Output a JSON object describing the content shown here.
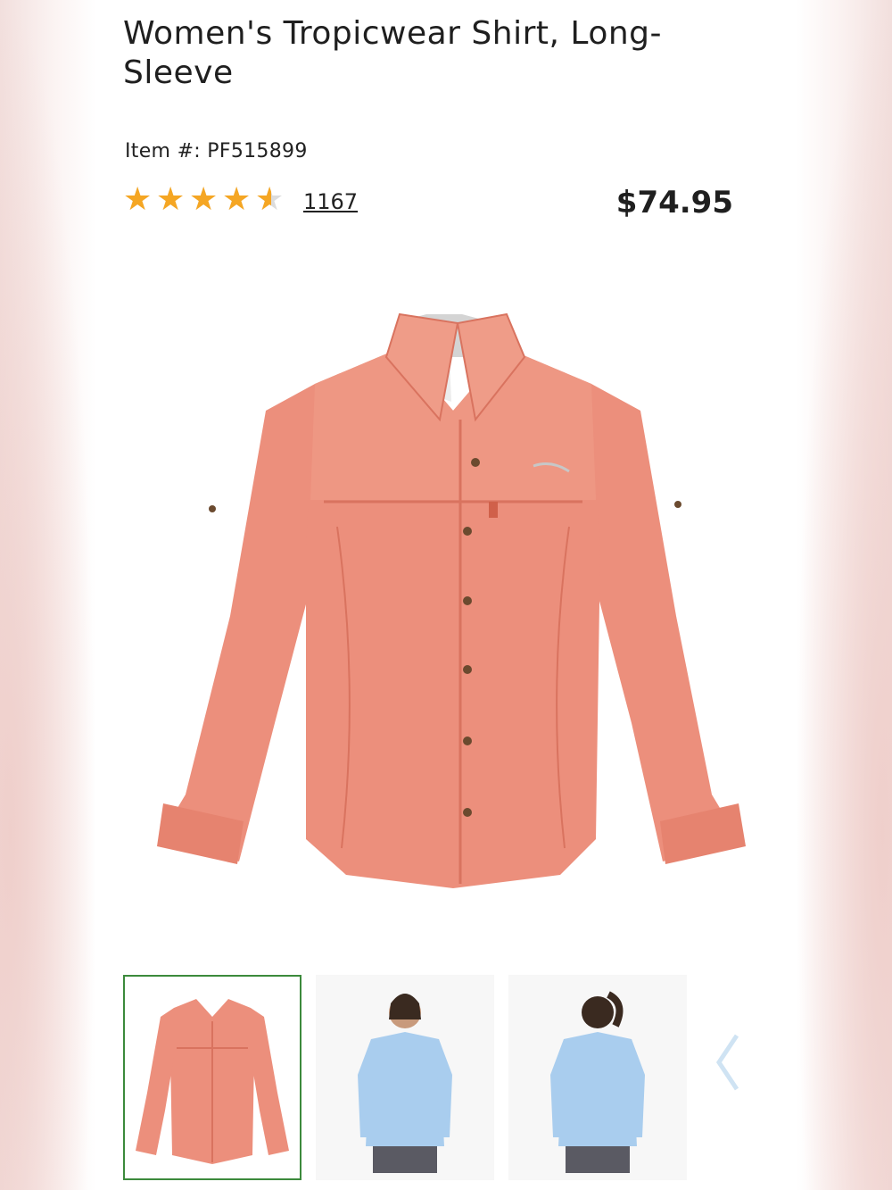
{
  "product": {
    "title": "Women's Tropicwear Shirt, Long-Sleeve",
    "item_number": "Item #: PF515899",
    "rating": 4.5,
    "rating_max": 5,
    "review_count": "1167",
    "price": "$74.95"
  },
  "gallery": {
    "main_image": "coral long-sleeve shirt",
    "thumbnails": [
      {
        "name": "coral shirt flat",
        "selected": true
      },
      {
        "name": "model front light blue shirt",
        "selected": false
      },
      {
        "name": "model back light blue shirt",
        "selected": false
      }
    ],
    "next_icon": "chevron-right-icon"
  },
  "colors": {
    "shirt": "#ec8f7c",
    "shirt_shadow": "#d9735f",
    "star": "#f5a623",
    "thumb_border": "#3c8a3c",
    "blue_shirt": "#a9cdee"
  }
}
